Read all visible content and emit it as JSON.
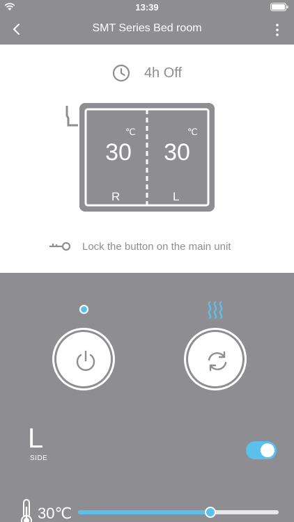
{
  "status_bar": {
    "time": "13:39"
  },
  "nav": {
    "title": "SMT Series  Bed room"
  },
  "timer": {
    "text": "4h Off"
  },
  "bed": {
    "right": {
      "temp": "30",
      "unit": "℃",
      "side": "R"
    },
    "left": {
      "temp": "30",
      "unit": "℃",
      "side": "L"
    }
  },
  "lock": {
    "text": "Lock the button on the main unit"
  },
  "controls": {
    "power_icon": "power-icon",
    "cycle_icon": "refresh-icon",
    "heat_icon": "heat-waves-icon",
    "status_dot_color": "#5bc0eb"
  },
  "side": {
    "letter": "L",
    "label": "SIDE",
    "toggle_on": true
  },
  "temperature": {
    "value": "30℃",
    "slider_fraction": 0.66
  },
  "colors": {
    "accent": "#5bc0eb",
    "background": "#8e8d91",
    "panel": "#ffffff"
  }
}
